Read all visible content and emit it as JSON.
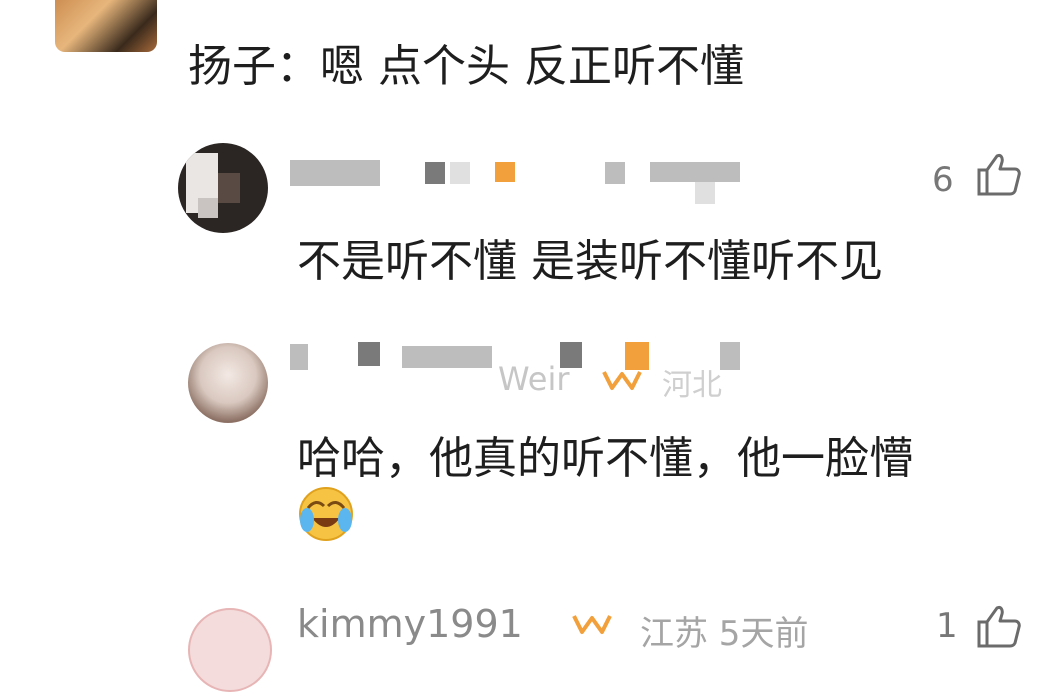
{
  "comments": [
    {
      "name": "",
      "content": "扬子：嗯 点个头 反正听不懂"
    },
    {
      "likes": "6",
      "content": "不是听不懂 是装听不懂听不见"
    },
    {
      "name_fragment": "Weir",
      "location_fragment": "河北",
      "content_line1": "哈哈，他真的听不懂，他一脸懵",
      "emoji": "laughing-crying-emoji"
    },
    {
      "name": "kimmy1991",
      "location_time": "江苏 5天前",
      "likes": "1"
    }
  ],
  "icons": {
    "like": "thumbs-up-icon",
    "vip": "vip-badge-icon"
  },
  "colors": {
    "text": "#1e1e1e",
    "meta": "#a5a5a5",
    "vip": "#f2a03b"
  }
}
